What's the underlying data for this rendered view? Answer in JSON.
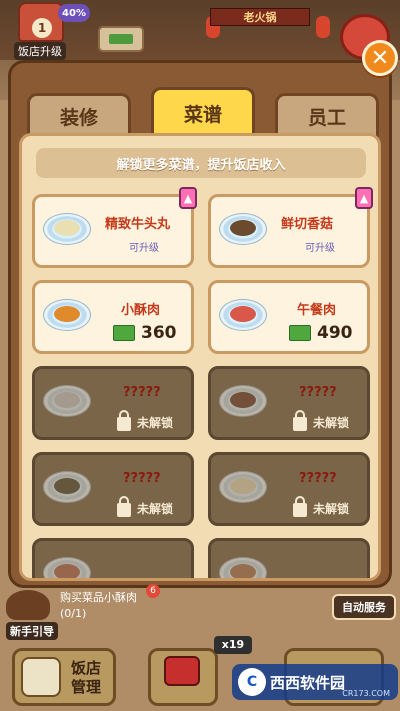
{
  "hud": {
    "shop_level": "1",
    "progress_badge": "40%",
    "upgrade_label": "饭店升级",
    "shop_sign": "老火锅"
  },
  "tabs": [
    {
      "label": "装修",
      "active": false
    },
    {
      "label": "菜谱",
      "active": true
    },
    {
      "label": "员工",
      "active": false
    }
  ],
  "banner": "解锁更多菜谱，提升饭店收入",
  "recipes": [
    {
      "name": "精致牛头丸",
      "status": "可升级",
      "upgradable": true,
      "food_color": "#e9dfb0"
    },
    {
      "name": "鲜切香菇",
      "status": "可升级",
      "upgradable": true,
      "food_color": "#6b4a2e"
    },
    {
      "name": "小酥肉",
      "price": "360",
      "food_color": "#e08a2c"
    },
    {
      "name": "午餐肉",
      "price": "490",
      "food_color": "#d9584a"
    },
    {
      "name": "?????",
      "status": "未解锁",
      "locked": true,
      "food_color": "#c7c7c7"
    },
    {
      "name": "?????",
      "status": "未解锁",
      "locked": true,
      "food_color": "#8a3a1e"
    },
    {
      "name": "?????",
      "status": "未解锁",
      "locked": true,
      "food_color": "#5a4a2a"
    },
    {
      "name": "?????",
      "status": "未解锁",
      "locked": true,
      "food_color": "#e8d79a"
    }
  ],
  "bottom": {
    "guide_label": "新手引导",
    "task_text": "购买菜品小酥肉(0/1)",
    "task_badge": "6",
    "auto_service": "自动服务",
    "manage_label": "饭店管理",
    "multiplier": "x19",
    "watermark_text": "西西软件园",
    "watermark_url": "CR173.COM"
  },
  "icons": {
    "close": "close-icon",
    "cash": "cash-icon",
    "lock": "lock-icon",
    "upgrade": "upgrade-arrow-icon"
  }
}
